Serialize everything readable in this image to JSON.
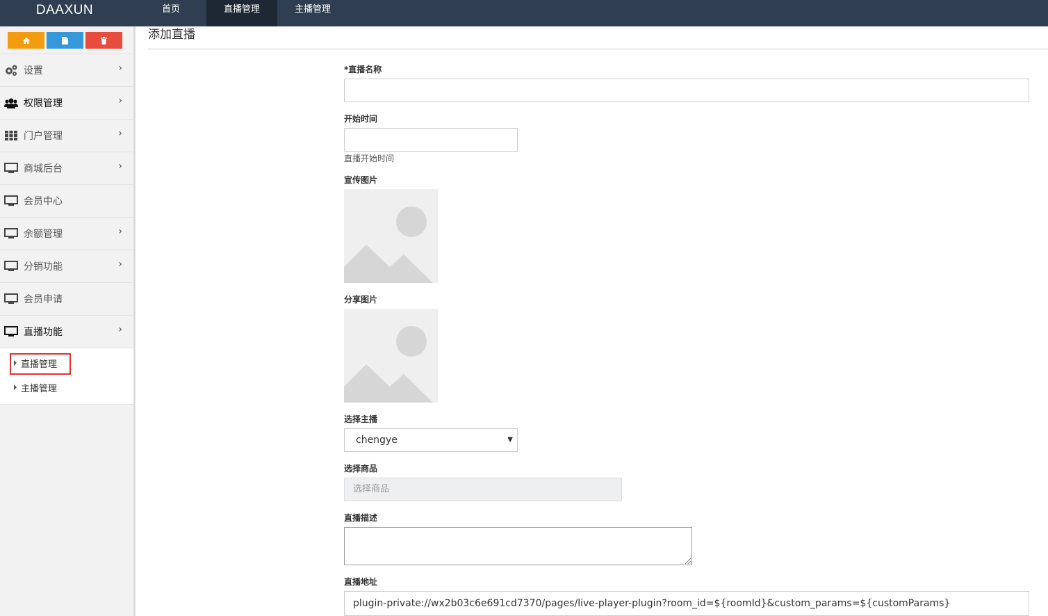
{
  "brand": "DAAXUN",
  "topnav": [
    {
      "label": "首页",
      "active": false
    },
    {
      "label": "直播管理",
      "active": true
    },
    {
      "label": "主播管理",
      "active": false
    }
  ],
  "quick_buttons": [
    {
      "icon": "home-icon",
      "color": "#f39c12"
    },
    {
      "icon": "file-icon",
      "color": "#3498db"
    },
    {
      "icon": "trash-icon",
      "color": "#e74c3c"
    }
  ],
  "sidebar": {
    "items": [
      {
        "label": "设置",
        "icon": "gears-icon",
        "chevron": true
      },
      {
        "label": "权限管理",
        "icon": "users-icon",
        "chevron": true
      },
      {
        "label": "门户管理",
        "icon": "grid-icon",
        "chevron": true
      },
      {
        "label": "商城后台",
        "icon": "monitor-icon",
        "chevron": true
      },
      {
        "label": "会员中心",
        "icon": "monitor-icon",
        "chevron": false
      },
      {
        "label": "余额管理",
        "icon": "monitor-icon",
        "chevron": true
      },
      {
        "label": "分销功能",
        "icon": "monitor-icon",
        "chevron": true
      },
      {
        "label": "会员申请",
        "icon": "monitor-icon",
        "chevron": false
      },
      {
        "label": "直播功能",
        "icon": "monitor-icon",
        "chevron": true
      }
    ],
    "subitems": [
      {
        "label": "直播管理"
      },
      {
        "label": "主播管理"
      }
    ]
  },
  "page": {
    "title": "添加直播"
  },
  "form": {
    "name_label": "*直播名称",
    "name_value": "",
    "start_label": "开始时间",
    "start_value": "",
    "start_help": "直播开始时间",
    "promo_image_label": "宣传图片",
    "share_image_label": "分享图片",
    "anchor_label": "选择主播",
    "anchor_value": "chengye",
    "goods_label": "选择商品",
    "goods_placeholder": "选择商品",
    "desc_label": "直播描述",
    "desc_value": "",
    "url_label": "直播地址",
    "url_value": "plugin-private://wx2b03c6e691cd7370/pages/live-player-plugin?room_id=${roomId}&custom_params=${customParams}"
  }
}
